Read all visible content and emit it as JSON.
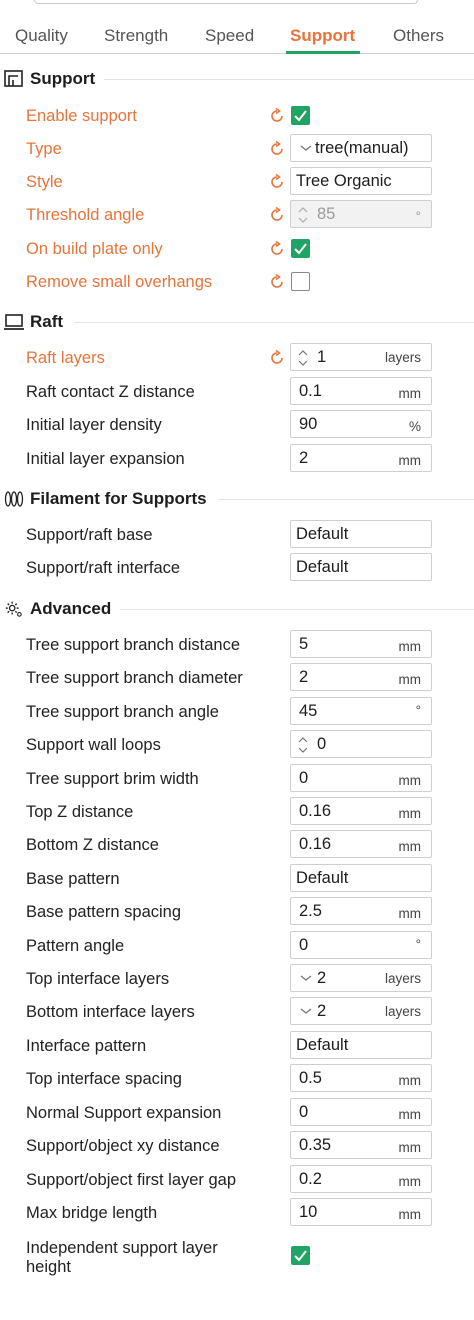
{
  "tabs": [
    {
      "label": "Quality"
    },
    {
      "label": "Strength"
    },
    {
      "label": "Speed"
    },
    {
      "label": "Support"
    },
    {
      "label": "Others"
    }
  ],
  "colors": {
    "accent": "#e8743b",
    "check": "#1fa463"
  },
  "sections": {
    "support": {
      "title": "Support",
      "enable_support": {
        "label": "Enable support",
        "checked": true
      },
      "type": {
        "label": "Type",
        "value": "tree(manual)"
      },
      "style": {
        "label": "Style",
        "value": "Tree Organic"
      },
      "threshold_angle": {
        "label": "Threshold angle",
        "value": "85",
        "unit": "°"
      },
      "on_build_plate_only": {
        "label": "On build plate only",
        "checked": true
      },
      "remove_small_overhangs": {
        "label": "Remove small overhangs",
        "checked": false
      }
    },
    "raft": {
      "title": "Raft",
      "raft_layers": {
        "label": "Raft layers",
        "value": "1",
        "unit": "layers"
      },
      "raft_contact_z": {
        "label": "Raft contact Z distance",
        "value": "0.1",
        "unit": "mm"
      },
      "initial_layer_density": {
        "label": "Initial layer density",
        "value": "90",
        "unit": "%"
      },
      "initial_layer_expansion": {
        "label": "Initial layer expansion",
        "value": "2",
        "unit": "mm"
      }
    },
    "filament": {
      "title": "Filament for Supports",
      "base": {
        "label": "Support/raft base",
        "value": "Default"
      },
      "interface": {
        "label": "Support/raft interface",
        "value": "Default"
      }
    },
    "advanced": {
      "title": "Advanced",
      "branch_distance": {
        "label": "Tree support branch distance",
        "value": "5",
        "unit": "mm"
      },
      "branch_diameter": {
        "label": "Tree support branch diameter",
        "value": "2",
        "unit": "mm"
      },
      "branch_angle": {
        "label": "Tree support branch angle",
        "value": "45",
        "unit": "°"
      },
      "wall_loops": {
        "label": "Support wall loops",
        "value": "0"
      },
      "brim_width": {
        "label": "Tree support brim width",
        "value": "0",
        "unit": "mm"
      },
      "top_z": {
        "label": "Top Z distance",
        "value": "0.16",
        "unit": "mm"
      },
      "bottom_z": {
        "label": "Bottom Z distance",
        "value": "0.16",
        "unit": "mm"
      },
      "base_pattern": {
        "label": "Base pattern",
        "value": "Default"
      },
      "base_pattern_spacing": {
        "label": "Base pattern spacing",
        "value": "2.5",
        "unit": "mm"
      },
      "pattern_angle": {
        "label": "Pattern angle",
        "value": "0",
        "unit": "°"
      },
      "top_interface_layers": {
        "label": "Top interface layers",
        "value": "2",
        "unit": "layers"
      },
      "bottom_interface_layers": {
        "label": "Bottom interface layers",
        "value": "2",
        "unit": "layers"
      },
      "interface_pattern": {
        "label": "Interface pattern",
        "value": "Default"
      },
      "top_interface_spacing": {
        "label": "Top interface spacing",
        "value": "0.5",
        "unit": "mm"
      },
      "normal_expansion": {
        "label": "Normal Support expansion",
        "value": "0",
        "unit": "mm"
      },
      "xy_distance": {
        "label": "Support/object xy distance",
        "value": "0.35",
        "unit": "mm"
      },
      "first_layer_gap": {
        "label": "Support/object first layer gap",
        "value": "0.2",
        "unit": "mm"
      },
      "max_bridge_length": {
        "label": "Max bridge length",
        "value": "10",
        "unit": "mm"
      },
      "independent_layer_height": {
        "label": "Independent support layer height",
        "checked": true
      }
    }
  }
}
